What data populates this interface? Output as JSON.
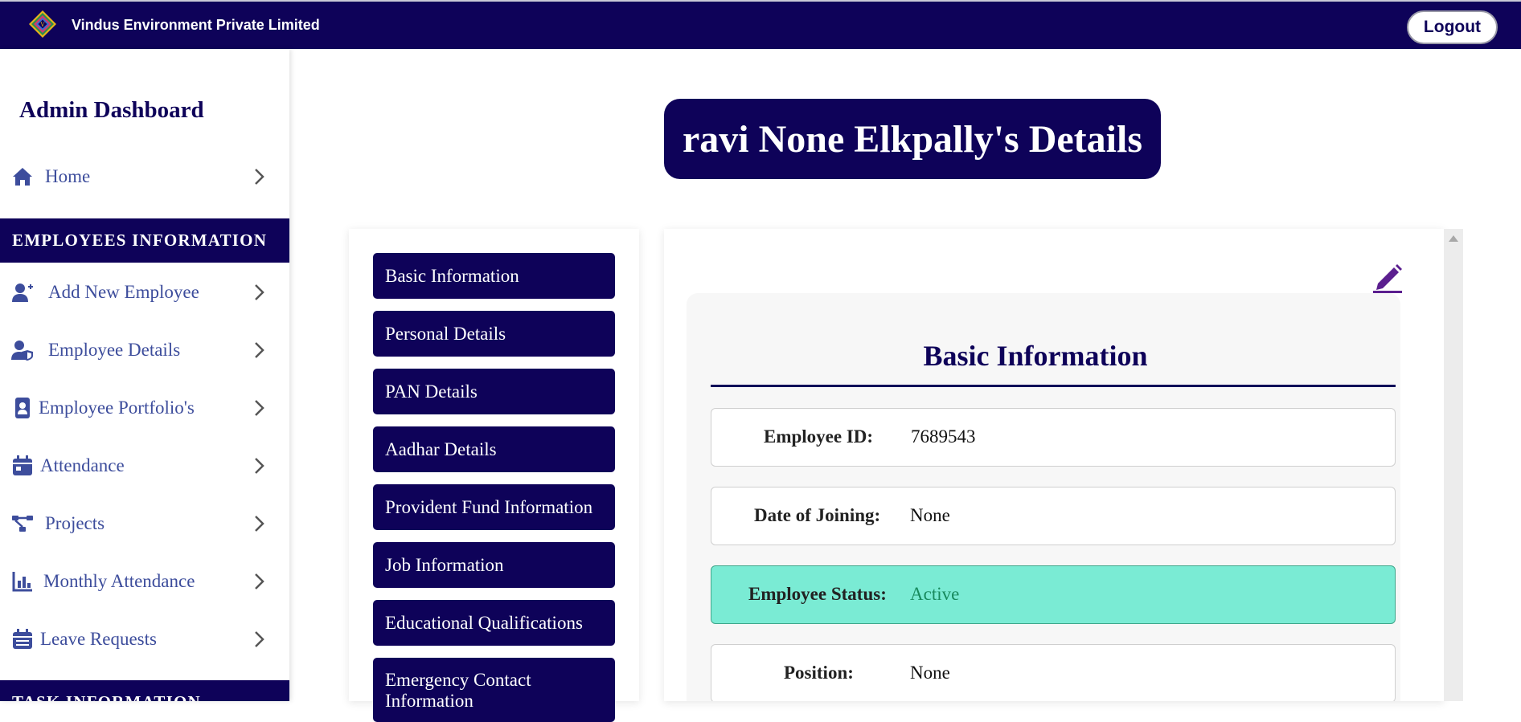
{
  "header": {
    "company_name": "Vindus Environment Private Limited",
    "logout_label": "Logout"
  },
  "sidebar": {
    "title": "Admin Dashboard",
    "home_label": "Home",
    "section_employees": "EMPLOYEES INFORMATION",
    "items": [
      {
        "label": "Add New Employee",
        "icon": "add-user-icon"
      },
      {
        "label": "Employee Details",
        "icon": "user-shield-icon"
      },
      {
        "label": "Employee Portfolio's",
        "icon": "id-badge-icon"
      },
      {
        "label": "Attendance",
        "icon": "calendar-icon"
      },
      {
        "label": "Projects",
        "icon": "diagram-project-icon"
      },
      {
        "label": "Monthly Attendance",
        "icon": "bar-chart-icon"
      },
      {
        "label": "Leave Requests",
        "icon": "calendar-days-icon"
      }
    ],
    "section_task": "TASK INFORMATION"
  },
  "page_title": "ravi None Elkpally's Details",
  "tabs": [
    "Basic Information",
    "Personal Details",
    "PAN Details",
    "Aadhar Details",
    "Provident Fund Information",
    "Job Information",
    "Educational Qualifications",
    "Emergency Contact Information"
  ],
  "details": {
    "section_title": "Basic Information",
    "fields": [
      {
        "label": "Employee ID:",
        "value": "7689543"
      },
      {
        "label": "Date of Joining:",
        "value": "None"
      },
      {
        "label": "Employee Status:",
        "value": "Active"
      },
      {
        "label": "Position:",
        "value": "None"
      }
    ]
  },
  "colors": {
    "navy": "#0e0259",
    "sidebar_text": "#3d4d9c",
    "active_status_bg": "#7aebd4",
    "active_status_text": "#188a5e",
    "edit_icon": "#5b1f8f"
  }
}
